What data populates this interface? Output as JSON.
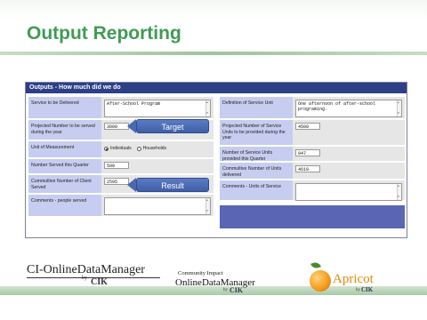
{
  "slide": {
    "title": "Output Reporting"
  },
  "panel": {
    "header": "Outputs - How much did we do",
    "left": [
      {
        "label": "Service to be Delivered",
        "value": "After-School Program",
        "kind": "textarea"
      },
      {
        "label": "Projected Number to be served during the year",
        "value": "3000",
        "kind": "input"
      },
      {
        "label": "Unit of Measurement",
        "kind": "radio",
        "options": [
          {
            "label": "Individuals",
            "selected": true
          },
          {
            "label": "Households",
            "selected": false
          }
        ]
      },
      {
        "label": "Number Served this Quarter",
        "value": "509",
        "kind": "input"
      },
      {
        "label": "Cummultive Number of Client Served",
        "value": "2595",
        "kind": "input"
      },
      {
        "label": "Comments - people served",
        "value": "",
        "kind": "textarea"
      }
    ],
    "right": [
      {
        "label": "Definition of Service Unit",
        "value": "One afternoon of after-school programing.",
        "kind": "textarea"
      },
      {
        "label": "Projected Number of Service Units to be provided during the year",
        "value": "4500",
        "kind": "input"
      },
      {
        "label": "Number of Service Units provided this Quarter",
        "value": "947",
        "kind": "input"
      },
      {
        "label": "Commultive Number of Units delivered",
        "value": "4619",
        "kind": "input"
      },
      {
        "label": "Comments - Units of Service",
        "value": "",
        "kind": "textarea"
      }
    ]
  },
  "callouts": {
    "target": "Target",
    "result": "Result"
  },
  "footer": {
    "logo1_main": "CI-OnlineDataManager",
    "logo1_by": "by",
    "logo1_cik": "CIK",
    "logo2_small": "Community Impact",
    "logo2_big": "OnlineDataManager",
    "logo2_by": "by",
    "logo2_cik": "CIK",
    "apricot": "Apricot",
    "apricot_by": "by",
    "apricot_cik": "CIK"
  },
  "colors": {
    "title": "#3f9b55",
    "header": "#2c3f87",
    "label_bg": "#c7cdf0",
    "callout": "#4a68b0"
  }
}
